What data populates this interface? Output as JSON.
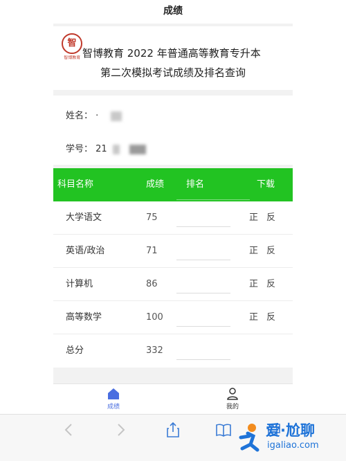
{
  "nav": {
    "title": "成绩"
  },
  "header": {
    "logo_glyph": "智",
    "logo_text": "智博教育",
    "line1": "智博教育 2022 年普通高等教育专升本",
    "line2": "第二次模拟考试成绩及排名查询"
  },
  "student": {
    "name_label": "姓名：",
    "name_value": "·",
    "id_label": "学号：",
    "id_value": "21"
  },
  "table": {
    "headers": {
      "subject": "科目名称",
      "score": "成绩",
      "rank": "排名",
      "download": "下载"
    },
    "rows": [
      {
        "subject": "大学语文",
        "score": "75",
        "rank": "",
        "front": "正",
        "back": "反"
      },
      {
        "subject": "英语/政治",
        "score": "71",
        "rank": "",
        "front": "正",
        "back": "反"
      },
      {
        "subject": "计算机",
        "score": "86",
        "rank": "",
        "front": "正",
        "back": "反"
      },
      {
        "subject": "高等数学",
        "score": "100",
        "rank": "",
        "front": "正",
        "back": "反"
      },
      {
        "subject": "总分",
        "score": "332",
        "rank": ""
      }
    ]
  },
  "tabbar": {
    "items": [
      {
        "label": "成绩",
        "icon": "home-icon",
        "active": true
      },
      {
        "label": "我的",
        "icon": "user-icon",
        "active": false
      }
    ]
  },
  "browser": {
    "icons": [
      "back-arrow-icon",
      "forward-arrow-icon",
      "share-icon",
      "bookmarks-icon",
      "tabs-icon"
    ]
  },
  "watermark": {
    "main": "爱·尬聊",
    "sub": "igaliao.com"
  },
  "colors": {
    "table_header": "#22c322",
    "active_tab": "#4a6ee0",
    "watermark": "#1e73d8",
    "logo": "#c0392b"
  }
}
